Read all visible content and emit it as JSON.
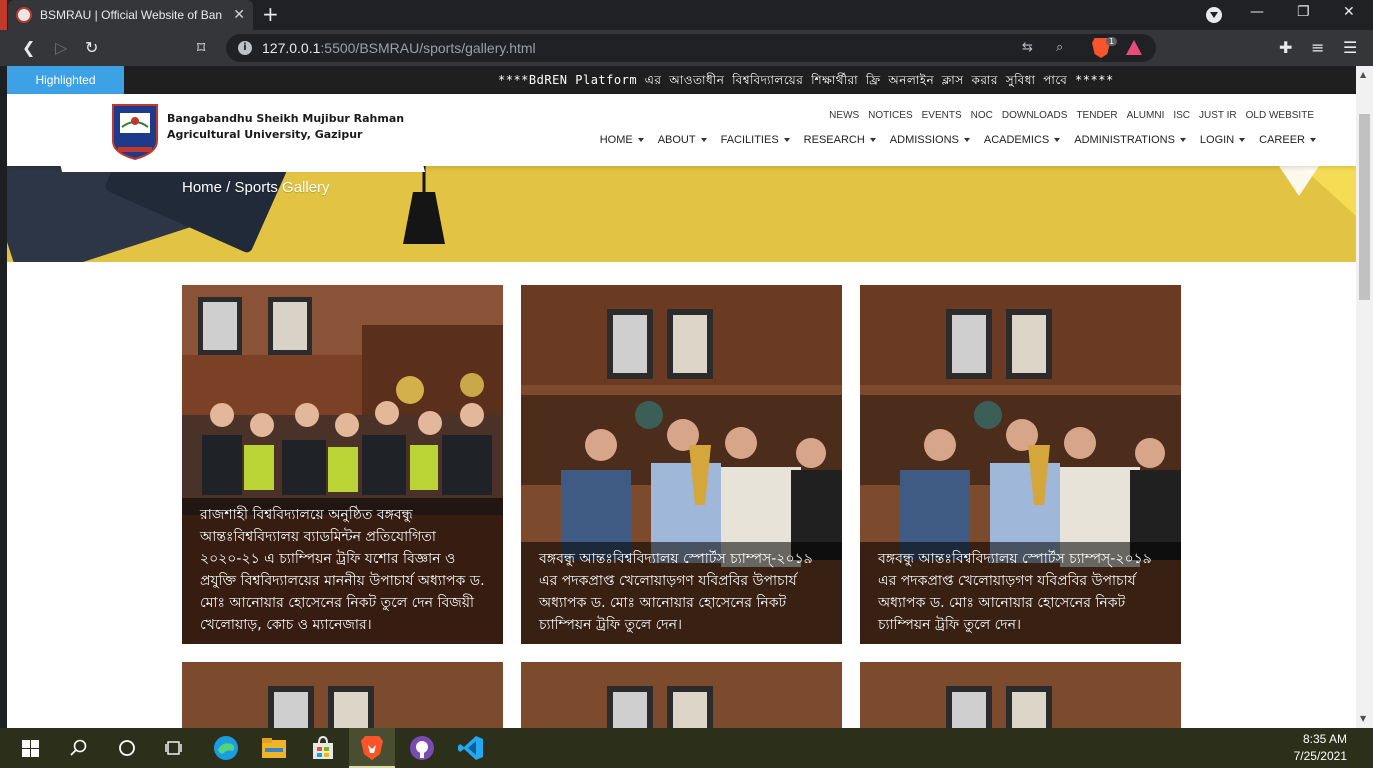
{
  "browser": {
    "tab_title": "BSMRAU | Official Website of Ban",
    "url_host": "127.0.0.1",
    "url_path": ":5500/BSMRAU/sports/gallery.html",
    "brave_badge": "1"
  },
  "notice": {
    "label": "Highlighted",
    "marquee": "****BdREN Platform এর আওতাধীন বিশ্ববিদ্যালয়ের শিক্ষার্থীরা ফ্রি অনলাইন ক্লাস করার সুবিধা পাবে *****"
  },
  "header": {
    "university_line1": "Bangabandhu Sheikh Mujibur Rahman",
    "university_line2": "Agricultural University, Gazipur",
    "top_links": [
      "NEWS",
      "NOTICES",
      "EVENTS",
      "NOC",
      "DOWNLOADS",
      "TENDER",
      "ALUMNI",
      "ISC",
      "JUST IR",
      "OLD WEBSITE"
    ],
    "main_menu": [
      "HOME",
      "ABOUT",
      "FACILITIES",
      "RESEARCH",
      "ADMISSIONS",
      "ACADEMICS",
      "ADMINISTRATIONS",
      "LOGIN",
      "CAREER"
    ]
  },
  "banner": {
    "breadcrumb": "Home / Sports Gallery"
  },
  "gallery": {
    "items": [
      {
        "caption": "রাজশাহী বিশ্ববিদ্যালয়ে অনুষ্ঠিত বঙ্গবন্ধু আন্তঃবিশ্ববিদ্যালয় ব্যাডমিন্টন প্রতিযোগিতা ২০২০-২১ এ চ্যাম্পিয়ন ট্রফি যশোর বিজ্ঞান ও প্রযুক্তি বিশ্ববিদ্যালয়ের মাননীয় উপাচার্য অধ্যাপক ড. মোঃ আনোয়ার হোসেনের নিকট তুলে দেন বিজয়ী খেলোয়াড়, কোচ ও ম্যানেজার।"
      },
      {
        "caption": "বঙ্গবন্ধু আন্তঃবিশ্ববিদ্যালয় স্পোর্টস চ্যাম্পস্-২০১৯ এর পদকপ্রাপ্ত খেলোয়াড়গণ যবিপ্রবির উপাচার্য অধ্যাপক ড. মোঃ আনোয়ার হোসেনের নিকট চ্যাম্পিয়ন ট্রফি তুলে দেন।"
      },
      {
        "caption": "বঙ্গবন্ধু আন্তঃবিশ্ববিদ্যালয় স্পোর্টস চ্যাম্পস্-২০১৯ এর পদকপ্রাপ্ত খেলোয়াড়গণ যবিপ্রবির উপাচার্য অধ্যাপক ড. মোঃ আনোয়ার হোসেনের নিকট চ্যাম্পিয়ন ট্রফি তুলে দেন।"
      }
    ]
  },
  "taskbar": {
    "time": "8:35 AM",
    "date": "7/25/2021"
  },
  "colors": {
    "highlight_blue": "#3da1e6",
    "banner_yellow": "#e2c343",
    "notice_bg": "#1f1f1f",
    "taskbar_bg": "#2c2f1a"
  }
}
